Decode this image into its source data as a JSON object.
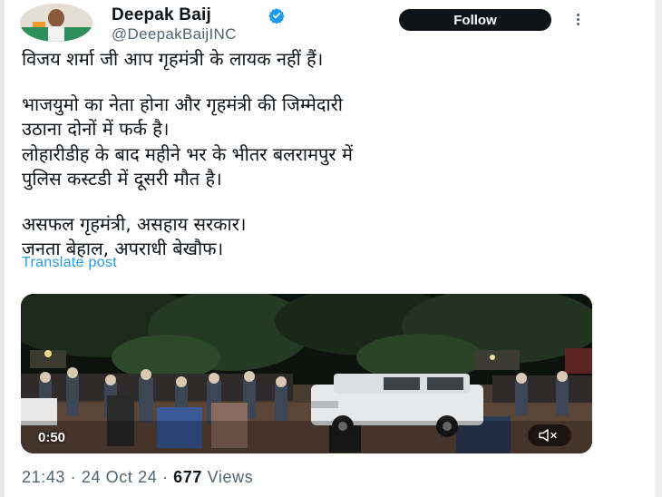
{
  "author": {
    "name": "Deepak Baij",
    "handle": "@DeepakBaijINC",
    "verified": true
  },
  "actions": {
    "follow_label": "Follow"
  },
  "tweet": {
    "lines": [
      "विजय शर्मा जी आप गृहमंत्री के लायक नहीं हैं।",
      "भाजयुमो का नेता होना और गृहमंत्री की जिम्मेदारी",
      "उठाना दोनों में फर्क है।",
      "लोहारीडीह के बाद महीने भर के भीतर बलरामपुर में",
      "पुलिस कस्टडी में दूसरी मौत है।",
      "असफल गृहमंत्री, असहाय सरकार।",
      "जनता बेहाल, अपराधी बेखौफ।"
    ],
    "translate_label": "Translate post"
  },
  "video": {
    "duration": "0:50"
  },
  "meta": {
    "time": "21:43",
    "date": "24 Oct 24",
    "views_count": "677",
    "views_label": "Views"
  },
  "icons": [
    "verified-badge-icon",
    "more-options-icon",
    "volume-muted-icon"
  ],
  "colors": {
    "accent": "#1d9bf0",
    "follow_bg": "#0f1419",
    "muted_text": "#536471"
  }
}
